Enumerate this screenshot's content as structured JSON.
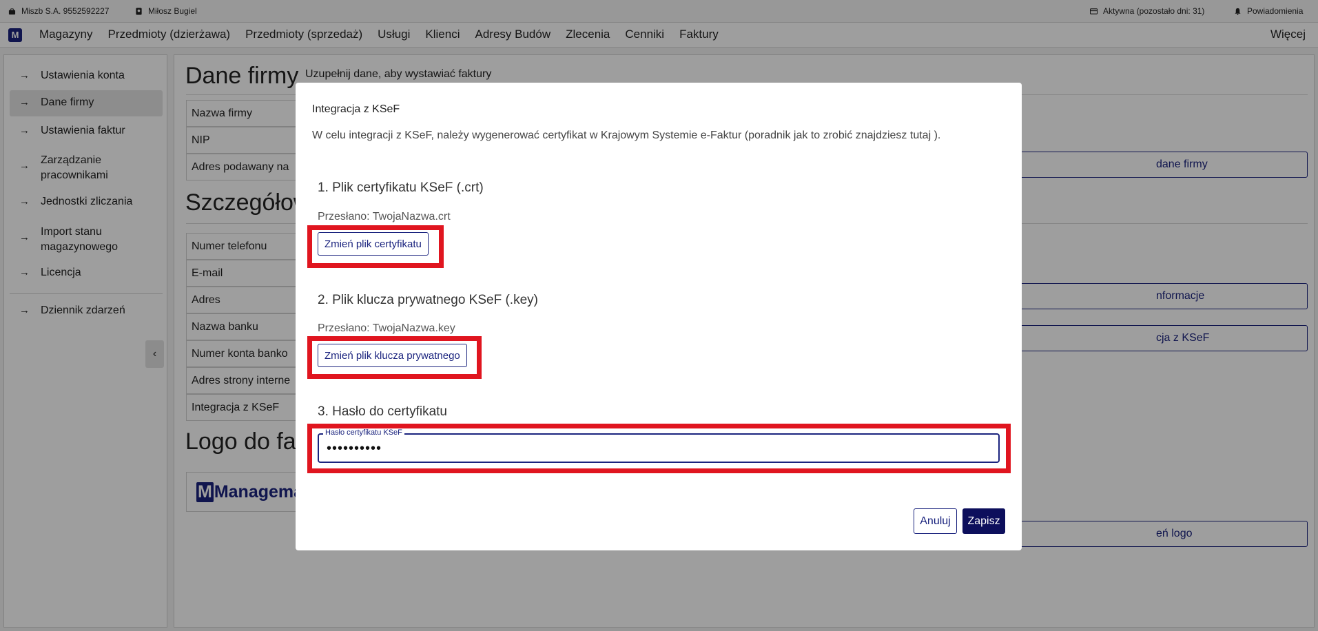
{
  "statusbar": {
    "company": "Miszb S.A. 9552592227",
    "user": "Miłosz Bugiel",
    "license": "Aktywna (pozostało dni: 31)",
    "notifications": "Powiadomienia"
  },
  "navbar": {
    "logo": "M",
    "items": [
      "Magazyny",
      "Przedmioty (dzierżawa)",
      "Przedmioty (sprzedaż)",
      "Usługi",
      "Klienci",
      "Adresy Budów",
      "Zlecenia",
      "Cenniki",
      "Faktury"
    ],
    "more": "Więcej"
  },
  "sidebar": {
    "items": [
      {
        "label": "Ustawienia konta"
      },
      {
        "label": "Dane firmy"
      },
      {
        "label": "Ustawienia faktur"
      },
      {
        "label": "Zarządzanie pracownikami"
      },
      {
        "label": "Jednostki zliczania"
      },
      {
        "label": "Import stanu magazynowego"
      },
      {
        "label": "Licencja"
      },
      {
        "label": "Dziennik zdarzeń"
      }
    ],
    "active_index": 1,
    "arrow_glyph": "→",
    "collapse_glyph": "‹"
  },
  "main": {
    "title": "Dane firmy",
    "subtitle": "Uzupełnij dane, aby wystawiać faktury",
    "section1_rows": [
      "Nazwa firmy",
      "NIP",
      "Adres podawany na"
    ],
    "section2_title": "Szczegółow",
    "section2_rows": [
      "Numer telefonu",
      "E-mail",
      "Adres",
      "Nazwa banku",
      "Numer konta banko",
      "Adres strony interne",
      "Integracja z KSeF"
    ],
    "section3_title": "Logo do fa",
    "logo_text": "Managemat",
    "right_buttons": [
      "dane firmy",
      "nformacje",
      "cja z KSeF",
      "eń logo"
    ]
  },
  "modal": {
    "title": "Integracja z KSeF",
    "description": "W celu integracji z KSeF, należy wygenerować certyfikat w Krajowym Systemie e-Faktur (poradnik jak to zrobić znajdziesz tutaj ).",
    "step1_title": "1. Plik certyfikatu KSeF (.crt)",
    "step1_uploaded": "Przesłano: TwojaNazwa.crt",
    "step1_button": "Zmień plik certyfikatu",
    "step2_title": "2. Plik klucza prywatnego KSeF (.key)",
    "step2_uploaded": "Przesłano: TwojaNazwa.key",
    "step2_button": "Zmień plik klucza prywatnego",
    "step3_title": "3. Hasło do certyfikatu",
    "password_label": "Hasło certyfikatu KSeF",
    "password_value": "••••••••••",
    "cancel": "Anuluj",
    "save": "Zapisz"
  },
  "colors": {
    "brand": "#1a237e",
    "highlight": "#e0151f",
    "save_button": "#0d0f5c"
  }
}
